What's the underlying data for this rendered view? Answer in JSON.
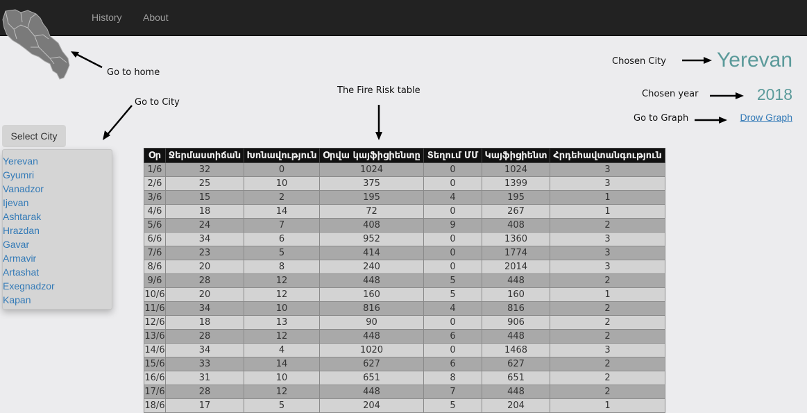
{
  "nav": {
    "items": [
      {
        "label": "History"
      },
      {
        "label": "About"
      }
    ]
  },
  "annotations": {
    "home": "Go to home",
    "city": "Go to City",
    "table": "The Fire Risk table",
    "chosen_city": "Chosen City",
    "chosen_year": "Chosen year",
    "graph": "Go to Graph"
  },
  "selection": {
    "city": "Yerevan",
    "year": "2018",
    "graph_link": "Drow Graph"
  },
  "city_select": {
    "button_label": "Select City",
    "cities": [
      "Yerevan",
      "Gyumri",
      "Vanadzor",
      "Ijevan",
      "Ashtarak",
      "Hrazdan",
      "Gavar",
      "Armavir",
      "Artashat",
      "Exegnadzor",
      "Kapan"
    ]
  },
  "table": {
    "headers": [
      "Օր",
      "Ջերմաստիճան",
      "Խոնավություն",
      "Օրվա կայֆիցիենտը",
      "Տեղում ՄՄ",
      "Կայֆիցիենտ",
      "Հրդեհավտանգություն"
    ],
    "rows": [
      [
        "1/6",
        "32",
        "0",
        "1024",
        "0",
        "1024",
        "3"
      ],
      [
        "2/6",
        "25",
        "10",
        "375",
        "0",
        "1399",
        "3"
      ],
      [
        "3/6",
        "15",
        "2",
        "195",
        "4",
        "195",
        "1"
      ],
      [
        "4/6",
        "18",
        "14",
        "72",
        "0",
        "267",
        "1"
      ],
      [
        "5/6",
        "24",
        "7",
        "408",
        "9",
        "408",
        "2"
      ],
      [
        "6/6",
        "34",
        "6",
        "952",
        "0",
        "1360",
        "3"
      ],
      [
        "7/6",
        "23",
        "5",
        "414",
        "0",
        "1774",
        "3"
      ],
      [
        "8/6",
        "20",
        "8",
        "240",
        "0",
        "2014",
        "3"
      ],
      [
        "9/6",
        "28",
        "12",
        "448",
        "5",
        "448",
        "2"
      ],
      [
        "10/6",
        "20",
        "12",
        "160",
        "5",
        "160",
        "1"
      ],
      [
        "11/6",
        "34",
        "10",
        "816",
        "4",
        "816",
        "2"
      ],
      [
        "12/6",
        "18",
        "13",
        "90",
        "0",
        "906",
        "2"
      ],
      [
        "13/6",
        "28",
        "12",
        "448",
        "6",
        "448",
        "2"
      ],
      [
        "14/6",
        "34",
        "4",
        "1020",
        "0",
        "1468",
        "3"
      ],
      [
        "15/6",
        "33",
        "14",
        "627",
        "6",
        "627",
        "2"
      ],
      [
        "16/6",
        "31",
        "10",
        "651",
        "8",
        "651",
        "2"
      ],
      [
        "17/6",
        "28",
        "12",
        "448",
        "7",
        "448",
        "2"
      ],
      [
        "18/6",
        "17",
        "5",
        "204",
        "5",
        "204",
        "1"
      ]
    ]
  }
}
